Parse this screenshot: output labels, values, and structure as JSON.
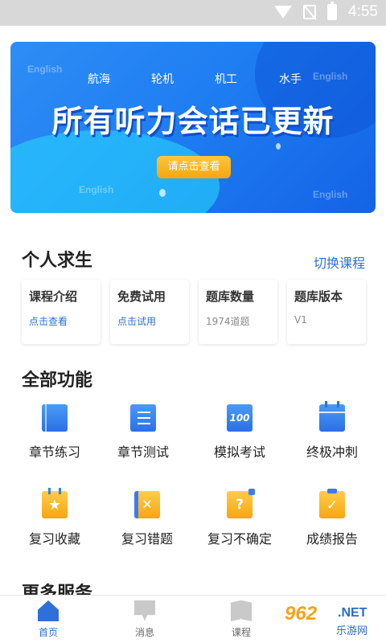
{
  "status_bar": {
    "time": "4:55"
  },
  "banner": {
    "watermarks": [
      "English",
      "English",
      "English",
      "English"
    ],
    "categories": [
      "航海",
      "轮机",
      "机工",
      "水手"
    ],
    "headline": "所有听力会话已更新",
    "cta_label": "请点击查看"
  },
  "course": {
    "title": "个人求生",
    "switch_label": "切换课程",
    "cards": [
      {
        "title": "课程介绍",
        "value": "点击查看"
      },
      {
        "title": "免费试用",
        "value": "点击试用"
      },
      {
        "title": "题库数量",
        "value": "1974道题"
      },
      {
        "title": "题库版本",
        "value": "V1"
      }
    ]
  },
  "functions": {
    "title": "全部功能",
    "items": [
      {
        "label": "章节练习",
        "icon": "book-icon"
      },
      {
        "label": "章节测试",
        "icon": "list-icon"
      },
      {
        "label": "模拟考试",
        "icon": "score-100-icon",
        "glyph": "100"
      },
      {
        "label": "终极冲刺",
        "icon": "calendar-icon"
      },
      {
        "label": "复习收藏",
        "icon": "star-calendar-icon",
        "glyph": "★"
      },
      {
        "label": "复习错题",
        "icon": "wrong-book-icon",
        "glyph": "✕"
      },
      {
        "label": "复习不确定",
        "icon": "question-icon",
        "glyph": "?"
      },
      {
        "label": "成绩报告",
        "icon": "clipboard-check-icon",
        "glyph": "✓"
      }
    ]
  },
  "more_services": {
    "title": "更多服务"
  },
  "bottom_nav": {
    "items": [
      {
        "label": "首页",
        "icon": "home-icon",
        "active": true
      },
      {
        "label": "消息",
        "icon": "message-icon",
        "active": false
      },
      {
        "label": "课程",
        "icon": "course-book-icon",
        "active": false
      }
    ]
  },
  "site_watermark": {
    "number": "962",
    "suffix": ".NET",
    "name": "乐游网"
  },
  "colors": {
    "accent": "#2e6fd8",
    "banner_blue": "#1f7ef2",
    "cta_orange": "#f6a611",
    "icon_yellow": "#ffcd4a"
  }
}
